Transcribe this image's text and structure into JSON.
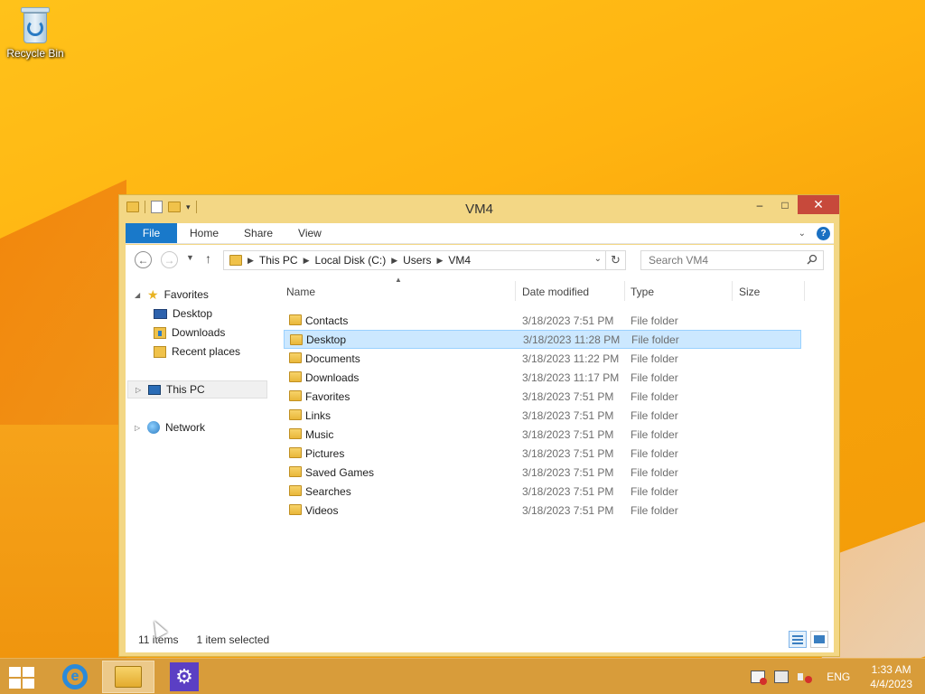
{
  "desktop": {
    "icons": [
      {
        "label": "Recycle Bin"
      }
    ]
  },
  "window": {
    "title": "VM4",
    "controls": {
      "minimize": "–",
      "maximize": "□",
      "close": "✕"
    },
    "ribbon": {
      "tabs": [
        "File",
        "Home",
        "Share",
        "View"
      ],
      "help": "?"
    },
    "address": {
      "crumbs": [
        "This PC",
        "Local Disk (C:)",
        "Users",
        "VM4"
      ]
    },
    "search": {
      "placeholder": "Search VM4"
    },
    "nav_pane": {
      "favorites": "Favorites",
      "favorite_items": [
        "Desktop",
        "Downloads",
        "Recent places"
      ],
      "this_pc": "This PC",
      "network": "Network"
    },
    "columns": [
      "Name",
      "Date modified",
      "Type",
      "Size"
    ],
    "files": [
      {
        "name": "Contacts",
        "date": "3/18/2023 7:51 PM",
        "type": "File folder"
      },
      {
        "name": "Desktop",
        "date": "3/18/2023 11:28 PM",
        "type": "File folder"
      },
      {
        "name": "Documents",
        "date": "3/18/2023 11:22 PM",
        "type": "File folder"
      },
      {
        "name": "Downloads",
        "date": "3/18/2023 11:17 PM",
        "type": "File folder"
      },
      {
        "name": "Favorites",
        "date": "3/18/2023 7:51 PM",
        "type": "File folder"
      },
      {
        "name": "Links",
        "date": "3/18/2023 7:51 PM",
        "type": "File folder"
      },
      {
        "name": "Music",
        "date": "3/18/2023 7:51 PM",
        "type": "File folder"
      },
      {
        "name": "Pictures",
        "date": "3/18/2023 7:51 PM",
        "type": "File folder"
      },
      {
        "name": "Saved Games",
        "date": "3/18/2023 7:51 PM",
        "type": "File folder"
      },
      {
        "name": "Searches",
        "date": "3/18/2023 7:51 PM",
        "type": "File folder"
      },
      {
        "name": "Videos",
        "date": "3/18/2023 7:51 PM",
        "type": "File folder"
      }
    ],
    "status": {
      "count": "11 items",
      "selection": "1 item selected"
    }
  },
  "taskbar": {
    "tray": {
      "language": "ENG",
      "time": "1:33 AM",
      "date": "4/4/2023"
    }
  },
  "colors": {
    "accent": "#1979ca",
    "selection": "#cce8ff",
    "window_frame": "#f3d785",
    "close_button": "#c7493b"
  }
}
